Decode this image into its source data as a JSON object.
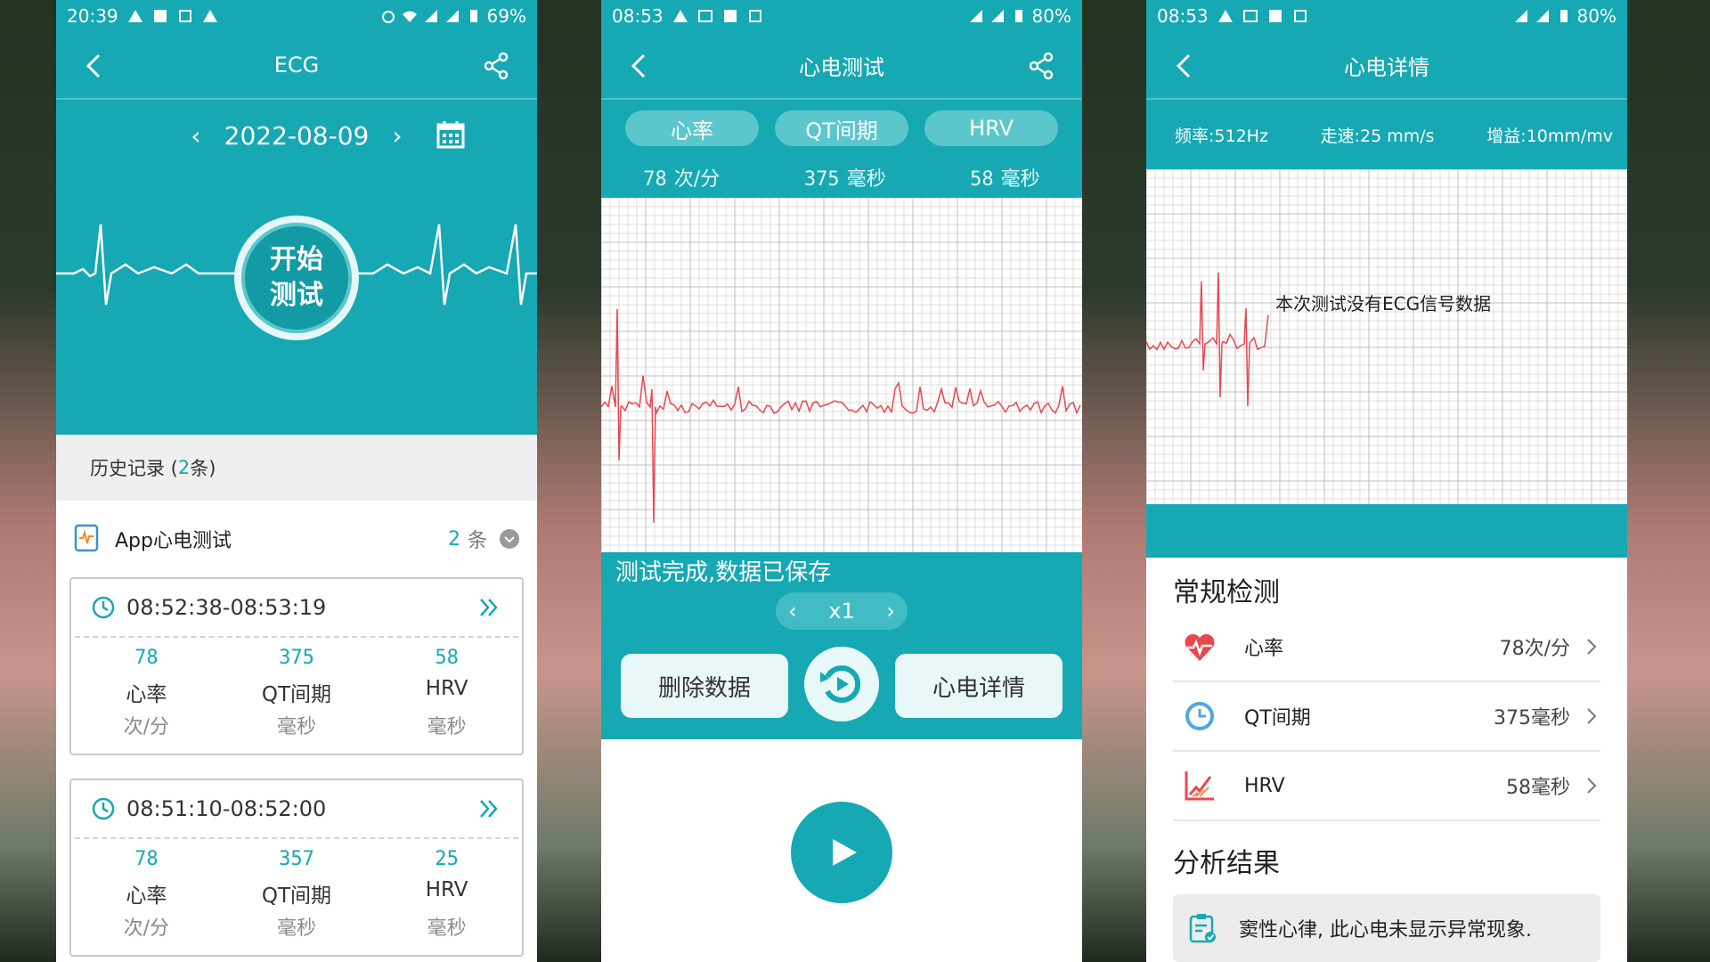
{
  "colors": {
    "accent": "#16a8b3",
    "ecg_line": "#e8484f",
    "grid": "#bfbfbf"
  },
  "panel1": {
    "status": {
      "time": "20:39",
      "battery": "69%"
    },
    "title": "ECG",
    "date": "2022-08-09",
    "start_button": {
      "line1": "开始",
      "line2": "测试"
    },
    "history": {
      "prefix": "历史记录 (",
      "count": "2",
      "suffix": "条)"
    },
    "group": {
      "label": "App心电测试",
      "count": "2",
      "unit": "条"
    },
    "records": [
      {
        "time": "08:52:38-08:53:19",
        "hr": "78",
        "hr_label": "心率",
        "hr_unit": "次/分",
        "qt": "375",
        "qt_label": "QT间期",
        "qt_unit": "毫秒",
        "hrv": "58",
        "hrv_label": "HRV",
        "hrv_unit": "毫秒"
      },
      {
        "time": "08:51:10-08:52:00",
        "hr": "78",
        "hr_label": "心率",
        "hr_unit": "次/分",
        "qt": "357",
        "qt_label": "QT间期",
        "qt_unit": "毫秒",
        "hrv": "25",
        "hrv_label": "HRV",
        "hrv_unit": "毫秒"
      }
    ]
  },
  "panel2": {
    "status": {
      "time": "08:53",
      "battery": "80%"
    },
    "title": "心电测试",
    "tabs": [
      "心率",
      "QT间期",
      "HRV"
    ],
    "values": [
      {
        "num": "78",
        "unit": "次/分"
      },
      {
        "num": "375",
        "unit": "毫秒"
      },
      {
        "num": "58",
        "unit": "毫秒"
      }
    ],
    "done_msg": "测试完成,数据已保存",
    "speed": "x1",
    "delete_label": "删除数据",
    "detail_label": "心电详情"
  },
  "panel3": {
    "status": {
      "time": "08:53",
      "battery": "80%"
    },
    "title": "心电详情",
    "freq": "频率:512Hz",
    "speed": "走速:25 mm/s",
    "gain": "增益:10mm/mv",
    "no_data": "本次测试没有ECG信号数据",
    "routine_title": "常规检测",
    "metrics": [
      {
        "label": "心率",
        "value": "78次/分",
        "icon": "heart-icon"
      },
      {
        "label": "QT间期",
        "value": "375毫秒",
        "icon": "clock-icon"
      },
      {
        "label": "HRV",
        "value": "58毫秒",
        "icon": "trend-chart-icon"
      }
    ],
    "analysis_title": "分析结果",
    "analysis_text": "窦性心律, 此心电未显示异常现象."
  }
}
